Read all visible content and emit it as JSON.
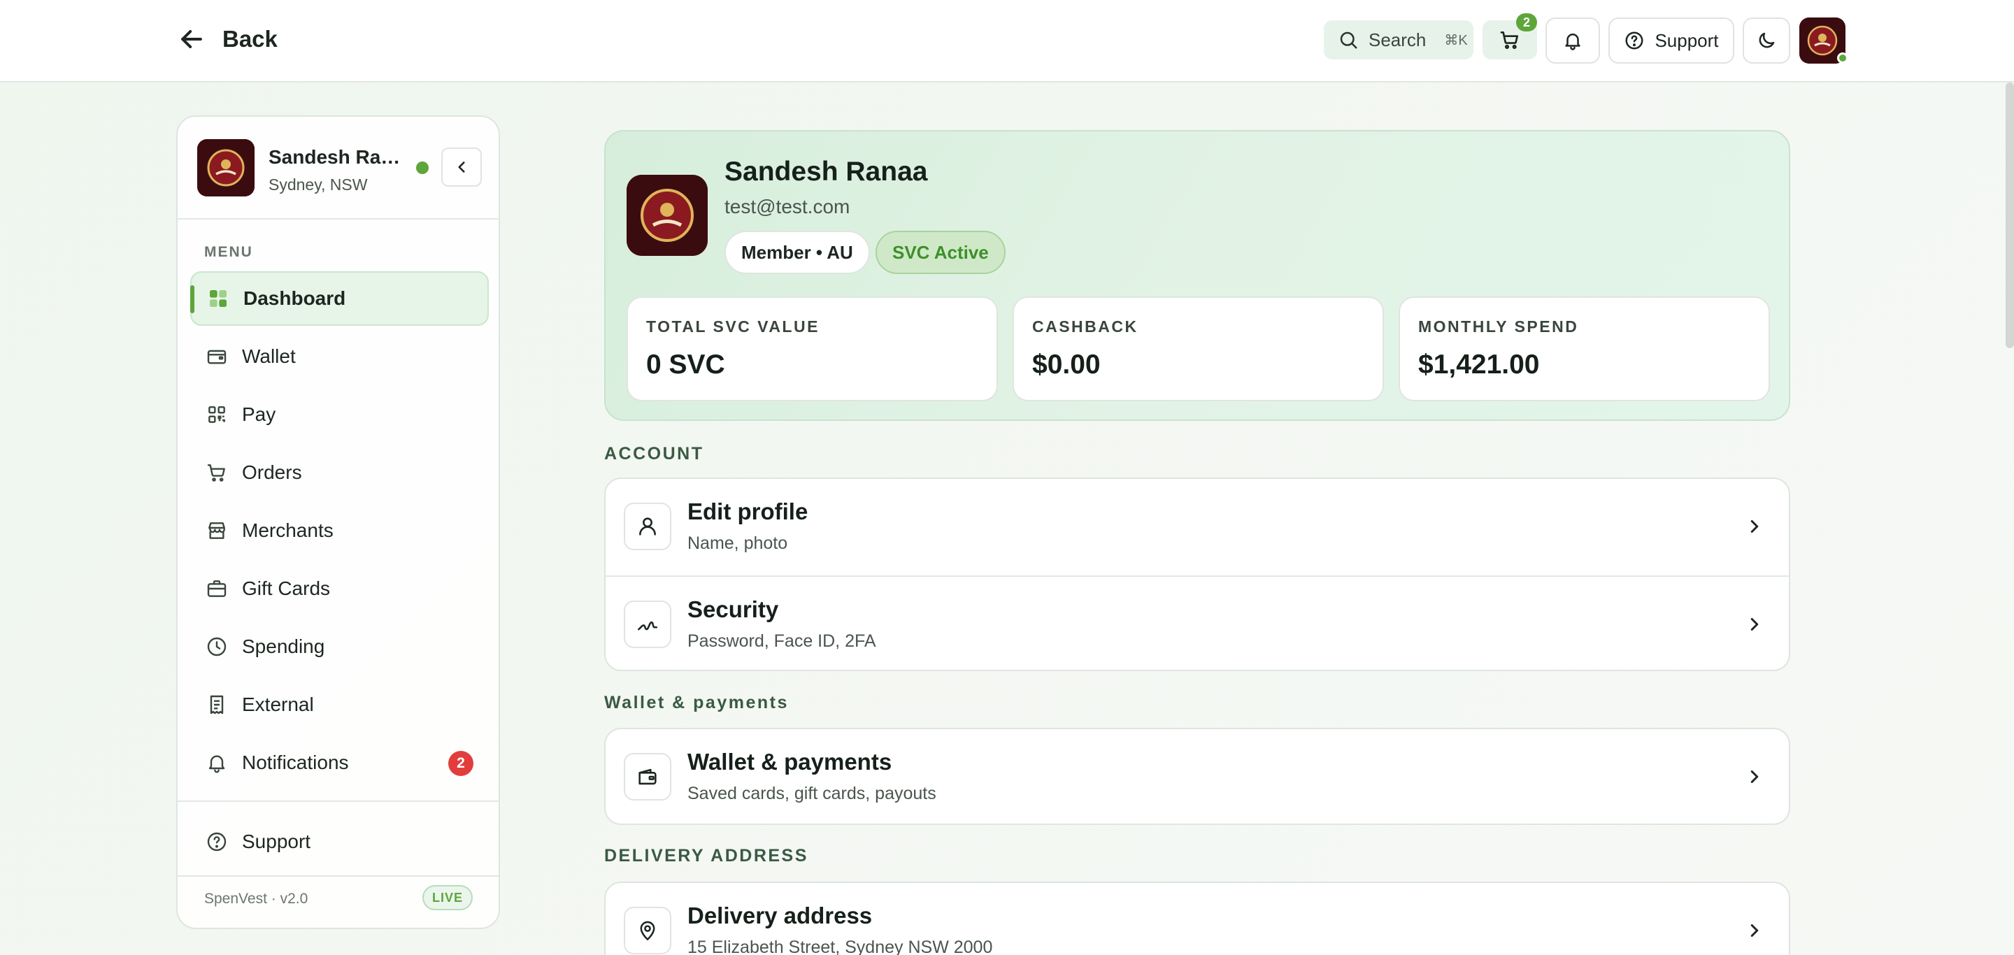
{
  "header": {
    "back_label": "Back",
    "search_label": "Search",
    "search_shortcut": "⌘K",
    "cart_count": "2",
    "support_label": "Support"
  },
  "sidebar": {
    "user_name": "Sandesh Ranaa",
    "user_location": "Sydney, NSW",
    "menu_label": "MENU",
    "items": [
      {
        "label": "Dashboard",
        "icon": "grid-icon",
        "active": true
      },
      {
        "label": "Wallet",
        "icon": "wallet-icon"
      },
      {
        "label": "Pay",
        "icon": "qr-icon"
      },
      {
        "label": "Orders",
        "icon": "cart-icon"
      },
      {
        "label": "Merchants",
        "icon": "store-icon"
      },
      {
        "label": "Gift Cards",
        "icon": "gift-card-icon"
      },
      {
        "label": "Spending",
        "icon": "clock-icon"
      },
      {
        "label": "External",
        "icon": "receipt-icon"
      },
      {
        "label": "Notifications",
        "icon": "bell-icon",
        "badge": "2"
      }
    ],
    "support_label": "Support",
    "version": "SpenVest · v2.0",
    "live_label": "LIVE"
  },
  "profile": {
    "name": "Sandesh Ranaa",
    "email": "test@test.com",
    "member_pill": "Member • AU",
    "svc_pill": "SVC Active",
    "stats": [
      {
        "title": "TOTAL SVC VALUE",
        "value": "0 SVC"
      },
      {
        "title": "CASHBACK",
        "value": "$0.00"
      },
      {
        "title": "MONTHLY SPEND",
        "value": "$1,421.00"
      }
    ]
  },
  "sections": {
    "account_label": "ACCOUNT",
    "wallet_label": "Wallet & payments",
    "delivery_label": "DELIVERY ADDRESS"
  },
  "rows": {
    "edit_profile": {
      "title": "Edit profile",
      "subtitle": "Name, photo"
    },
    "security": {
      "title": "Security",
      "subtitle": "Password, Face ID, 2FA"
    },
    "wallet": {
      "title": "Wallet & payments",
      "subtitle": "Saved cards, gift cards, payouts"
    },
    "delivery": {
      "title": "Delivery address",
      "subtitle": "15 Elizabeth Street, Sydney NSW 2000"
    }
  },
  "colors": {
    "accent": "#5ea53a",
    "badge_red": "#e23d3d",
    "avatar_bg": "#3b0c0f"
  }
}
